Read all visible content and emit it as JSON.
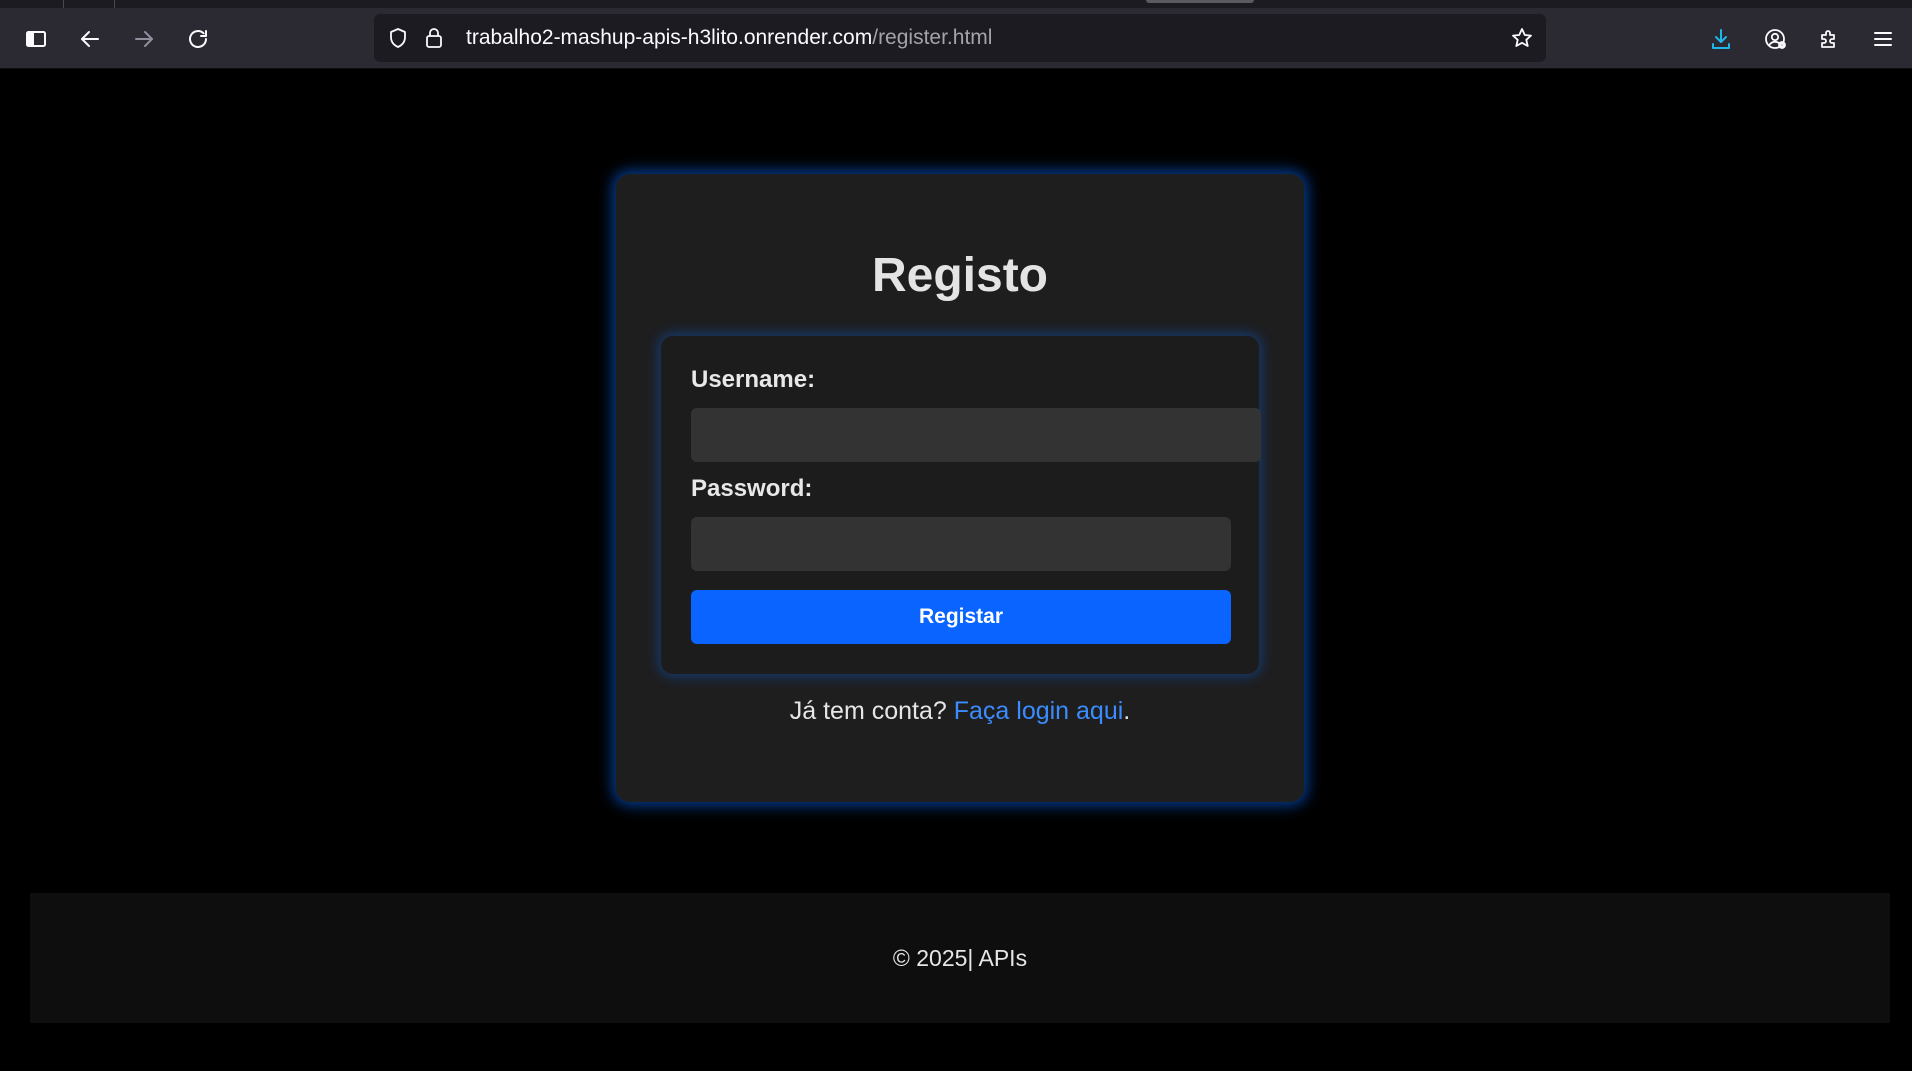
{
  "browser": {
    "url_host": "trabalho2-mashup-apis-h3lito.onrender.com",
    "url_path": "/register.html",
    "icons": {
      "sidebar": "sidebar-icon",
      "back": "back-arrow-icon",
      "forward": "forward-arrow-icon",
      "reload": "reload-icon",
      "tracking": "shield-icon",
      "secure": "lock-icon",
      "bookmark": "star-icon",
      "downloads": "download-icon",
      "account": "account-icon",
      "extensions": "puzzle-icon",
      "menu": "hamburger-menu-icon"
    },
    "colors": {
      "download_accent": "#1fb6e8"
    }
  },
  "register": {
    "title": "Registo",
    "username_label": "Username:",
    "username_value": "",
    "password_label": "Password:",
    "password_value": "",
    "submit_label": "Registar",
    "login_prompt": "Já tem conta? ",
    "login_link": "Faça login aqui",
    "login_suffix": "."
  },
  "footer": {
    "text": "© 2025| APIs"
  },
  "theme": {
    "accent": "#0a64ff",
    "link": "#3b8cff",
    "glow": "#0a6eff"
  }
}
